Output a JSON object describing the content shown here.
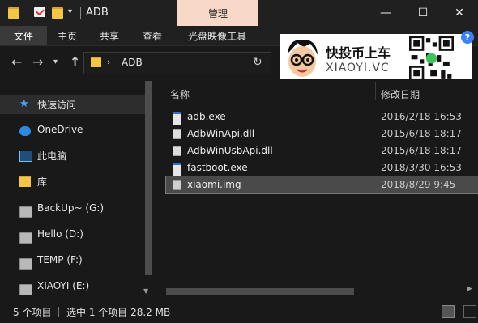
{
  "window": {
    "title": "ADB",
    "contextual_tab": "管理",
    "controls": [
      "—",
      "☐",
      "✕"
    ]
  },
  "ribbon": {
    "tabs": [
      "文件",
      "主页",
      "共享",
      "查看",
      "光盘映像工具"
    ]
  },
  "address": {
    "path": "ADB"
  },
  "sidebar": {
    "items": [
      {
        "label": "快速访问",
        "icon": "star-icon"
      },
      {
        "label": "OneDrive",
        "icon": "cloud-icon"
      },
      {
        "label": "此电脑",
        "icon": "computer-icon"
      },
      {
        "label": "库",
        "icon": "library-icon"
      },
      {
        "label": "BackUp~ (G:)",
        "icon": "drive-icon"
      },
      {
        "label": "Hello (D:)",
        "icon": "drive-icon"
      },
      {
        "label": "TEMP (F:)",
        "icon": "drive-icon"
      },
      {
        "label": "XIAOYI (E:)",
        "icon": "drive-icon"
      }
    ]
  },
  "content": {
    "columns": [
      "名称",
      "修改日期"
    ],
    "files": [
      {
        "name": "adb.exe",
        "date": "2016/2/18 16:53",
        "icon": "exe-icon"
      },
      {
        "name": "AdbWinApi.dll",
        "date": "2015/6/18 18:17",
        "icon": "dll-icon"
      },
      {
        "name": "AdbWinUsbApi.dll",
        "date": "2015/6/18 18:17",
        "icon": "dll-icon"
      },
      {
        "name": "fastboot.exe",
        "date": "2018/3/30 16:53",
        "icon": "exe-icon"
      },
      {
        "name": "xiaomi.img",
        "date": "2018/8/29 9:45",
        "icon": "disc-image-icon",
        "selected": true
      }
    ]
  },
  "status": {
    "count": "5 个项目",
    "selection": "选中 1 个项目  28.2 MB"
  },
  "watermark": {
    "brand_cn": "快投币上车",
    "brand_en": "XIAOYI.VC"
  },
  "colors": {
    "background": "#191919",
    "contextual_tab": "#f8d8c6",
    "selected_row": "#4a4a4a",
    "folder": "#f3c744",
    "accent": "#2f88e0"
  }
}
